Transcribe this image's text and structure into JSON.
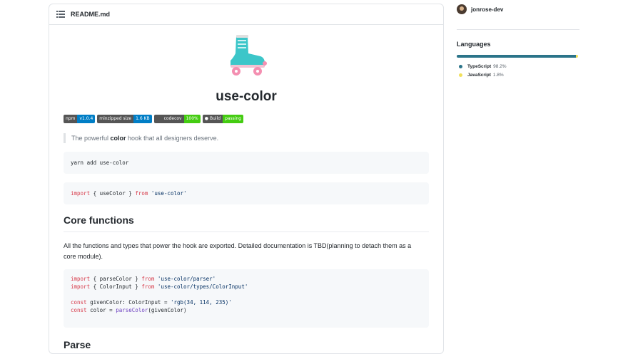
{
  "readme": {
    "filename": "README.md",
    "title": "use-color",
    "badges": [
      {
        "left": "npm",
        "right": "v1.0.4",
        "color": "#007ec6"
      },
      {
        "left": "minzipped size",
        "right": "1.6 KB",
        "color": "#007ec6"
      },
      {
        "left": "codecov",
        "right": "100%",
        "color": "#4c1"
      },
      {
        "left": "Build",
        "right": "passing",
        "color": "#4c1"
      }
    ],
    "tagline_prefix": "The powerful ",
    "tagline_bold": "color",
    "tagline_suffix": " hook that all designers deserve.",
    "install_cmd": "yarn add use-color",
    "import_line": {
      "kw": "import",
      "mid": " { useColor } ",
      "from": "from",
      "src": "'use-color'"
    },
    "core_heading": "Core functions",
    "core_paragraph": "All the functions and types that power the hook are exported. Detailed documentation is TBD(planning to detach them as a core module).",
    "code_lines": {
      "l1_kw": "import",
      "l1_mid": " { parseColor } ",
      "l1_from": "from",
      "l1_src": " 'use-color/parser'",
      "l2_kw": "import",
      "l2_mid": " { ColorInput } ",
      "l2_from": "from",
      "l2_src": " 'use-color/types/ColorInput'",
      "l3_kw": "const",
      "l3_mid": " givenColor: ColorInput = ",
      "l3_src": "'rgb(34, 114, 235)'",
      "l4_kw": "const",
      "l4_mid": " color = ",
      "l4_fn": "parseColor",
      "l4_rest": "(givenColor)"
    },
    "parse_heading": "Parse"
  },
  "sidebar": {
    "user": "jonrose-dev",
    "languages_title": "Languages",
    "languages": [
      {
        "name": "TypeScript",
        "percent": "98.2%",
        "value": 98.2,
        "color": "#2b7489"
      },
      {
        "name": "JavaScript",
        "percent": "1.8%",
        "value": 1.8,
        "color": "#f1e05a"
      }
    ]
  }
}
